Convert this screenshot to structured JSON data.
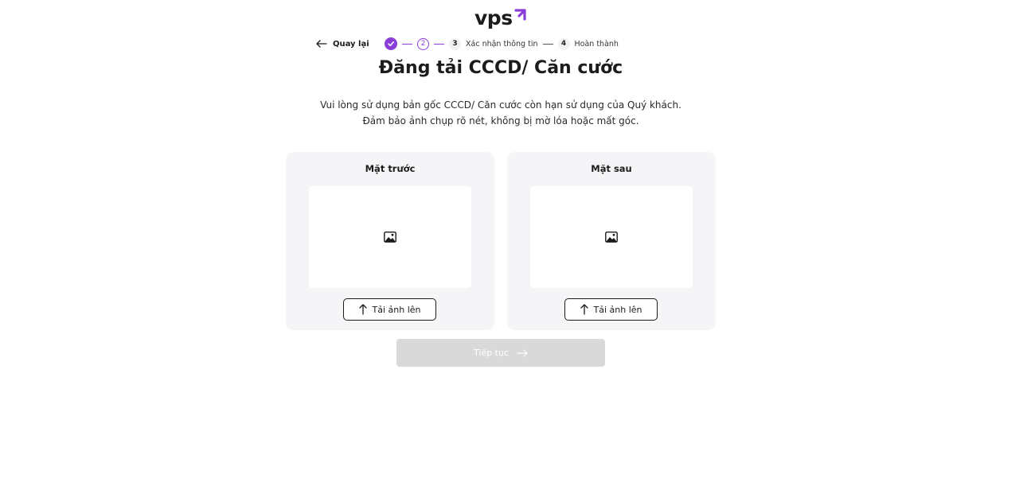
{
  "brand": {
    "logo_text": "vps",
    "accent_color": "#8a3ed8"
  },
  "nav": {
    "back_label": "Quay lại",
    "back_icon": "arrow-left-icon"
  },
  "stepper": {
    "step1_icon": "check-icon",
    "step2_number": "2",
    "step3_number": "3",
    "step3_label": "Xác nhận thông tin",
    "step4_number": "4",
    "step4_label": "Hoàn thành"
  },
  "page": {
    "title": "Đăng tải CCCD/ Căn cước",
    "description_line1": "Vui lòng sử dụng bản gốc CCCD/ Căn cước còn hạn sử dụng của Quý khách.",
    "description_line2": "Đảm bảo ảnh chụp rõ nét, không bị mờ lóa hoặc mất góc."
  },
  "cards": {
    "front": {
      "title": "Mặt trước",
      "placeholder_icon": "image-icon",
      "upload_label": "Tải ảnh lên",
      "upload_icon": "arrow-up-icon"
    },
    "back": {
      "title": "Mặt sau",
      "placeholder_icon": "image-icon",
      "upload_label": "Tải ảnh lên",
      "upload_icon": "arrow-up-icon"
    }
  },
  "continue_button": {
    "label": "Tiếp tục",
    "icon": "arrow-right-icon",
    "disabled_color": "#d9d9d9"
  }
}
